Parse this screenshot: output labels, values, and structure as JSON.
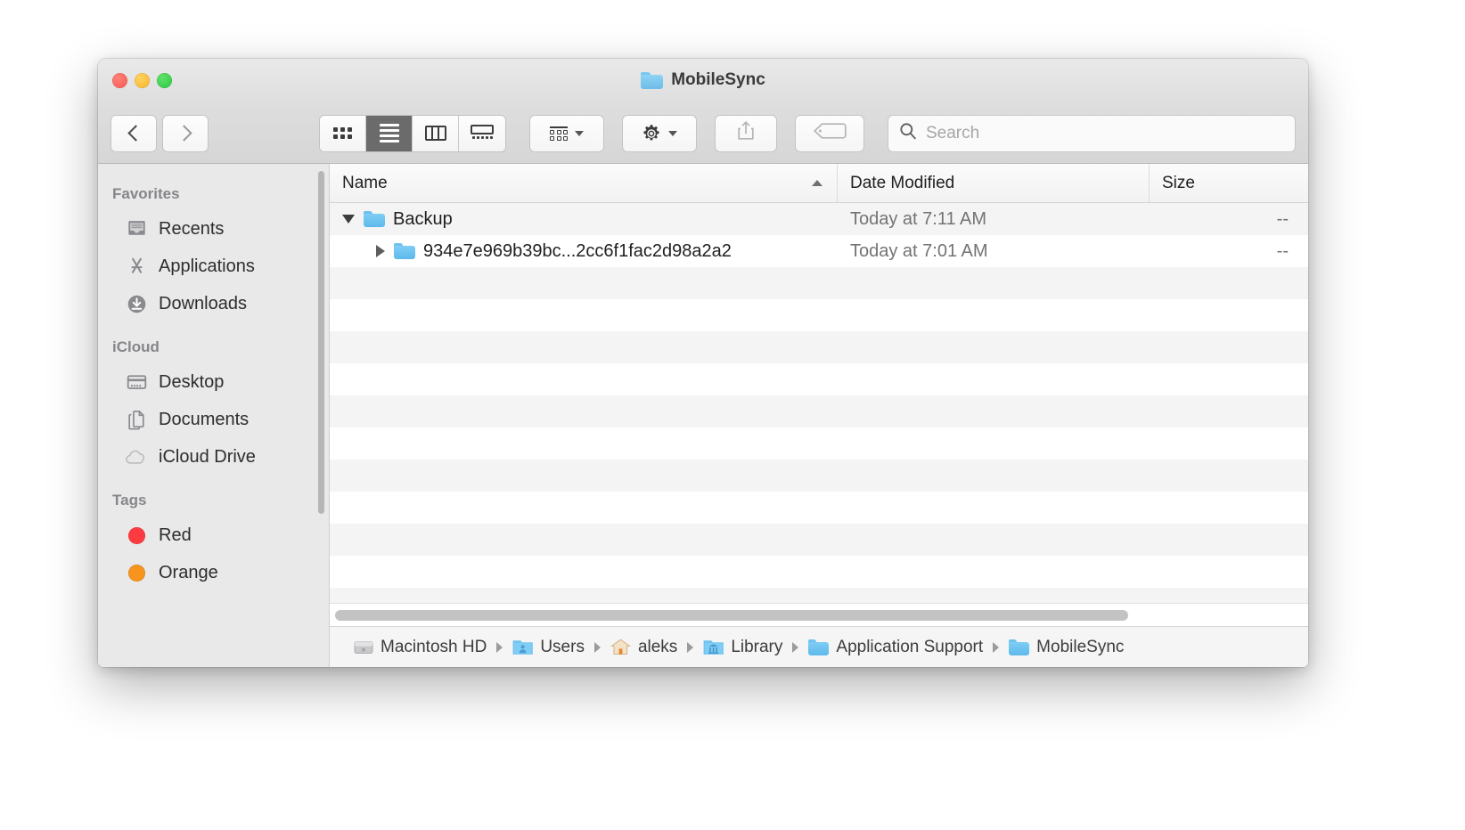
{
  "window": {
    "title": "MobileSync",
    "title_icon": "folder-icon",
    "traffic_lights": [
      {
        "name": "close",
        "color": "#f9564f"
      },
      {
        "name": "minimize",
        "color": "#f9b527"
      },
      {
        "name": "zoom",
        "color": "#27c93f"
      }
    ]
  },
  "toolbar": {
    "back_label": "Back",
    "forward_label": "Forward",
    "view_modes": [
      {
        "id": "icon",
        "icon": "icon-view-icon",
        "active": false
      },
      {
        "id": "list",
        "icon": "list-view-icon",
        "active": true
      },
      {
        "id": "column",
        "icon": "column-view-icon",
        "active": false
      },
      {
        "id": "gallery",
        "icon": "gallery-view-icon",
        "active": false
      }
    ],
    "arrange_label": "Arrange By",
    "action_label": "Action",
    "share_label": "Share",
    "tag_label": "Edit Tags"
  },
  "search": {
    "placeholder": "Search",
    "value": "",
    "icon": "search-icon"
  },
  "sidebar": {
    "sections": [
      {
        "title": "Favorites",
        "items": [
          {
            "label": "Recents",
            "icon": "recents-icon"
          },
          {
            "label": "Applications",
            "icon": "applications-icon"
          },
          {
            "label": "Downloads",
            "icon": "downloads-icon"
          }
        ]
      },
      {
        "title": "iCloud",
        "items": [
          {
            "label": "Desktop",
            "icon": "desktop-icon"
          },
          {
            "label": "Documents",
            "icon": "documents-icon"
          },
          {
            "label": "iCloud Drive",
            "icon": "icloud-drive-icon"
          }
        ]
      },
      {
        "title": "Tags",
        "items": [
          {
            "label": "Red",
            "icon": "tag-dot-icon",
            "color": "#fc3b40"
          },
          {
            "label": "Orange",
            "icon": "tag-dot-icon",
            "color": "#f7941e"
          }
        ]
      }
    ]
  },
  "file_list": {
    "columns": [
      {
        "key": "name",
        "label": "Name",
        "sorted": true,
        "sort_direction": "ascending"
      },
      {
        "key": "date",
        "label": "Date Modified",
        "sorted": false,
        "sort_direction": ""
      },
      {
        "key": "size",
        "label": "Size",
        "sorted": false,
        "sort_direction": ""
      }
    ],
    "rows": [
      {
        "name": "Backup",
        "date": "Today at 7:11 AM",
        "size": "--",
        "icon": "folder-icon",
        "depth": 1,
        "disclosure": "expanded"
      },
      {
        "name": "934e7e969b39bc...2cc6f1fac2d98a2a2",
        "date": "Today at 7:01 AM",
        "size": "--",
        "icon": "folder-icon",
        "depth": 2,
        "disclosure": "collapsed"
      }
    ]
  },
  "pathbar": {
    "segments": [
      {
        "label": "Macintosh HD",
        "icon": "hard-drive-icon"
      },
      {
        "label": "Users",
        "icon": "users-folder-icon"
      },
      {
        "label": "aleks",
        "icon": "home-folder-icon"
      },
      {
        "label": "Library",
        "icon": "library-folder-icon"
      },
      {
        "label": "Application Support",
        "icon": "folder-icon"
      },
      {
        "label": "MobileSync",
        "icon": "folder-icon"
      }
    ]
  }
}
